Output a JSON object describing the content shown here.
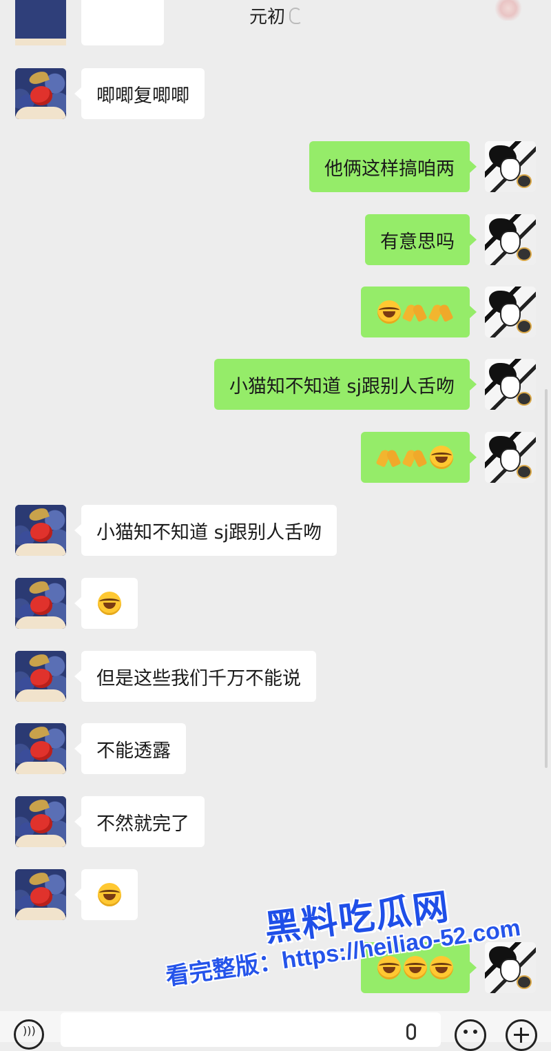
{
  "header": {
    "title": "元初"
  },
  "messages": [
    {
      "side": "left",
      "text": "唧唧复唧唧"
    },
    {
      "side": "right",
      "text": "他俩这样搞咱两"
    },
    {
      "side": "right",
      "text": "有意思吗"
    },
    {
      "side": "right",
      "emoji": [
        "laugh-cry",
        "clap",
        "clap"
      ]
    },
    {
      "side": "right",
      "text": "小猫知不知道 sj跟别人舌吻"
    },
    {
      "side": "right",
      "emoji": [
        "clap",
        "clap",
        "laugh-cry"
      ]
    },
    {
      "side": "left",
      "text": "小猫知不知道 sj跟别人舌吻"
    },
    {
      "side": "left",
      "emoji": [
        "laugh-cry"
      ]
    },
    {
      "side": "left",
      "text": "但是这些我们千万不能说"
    },
    {
      "side": "left",
      "text": "不能透露"
    },
    {
      "side": "left",
      "text": "不然就完了"
    },
    {
      "side": "left",
      "emoji": [
        "laugh-cry"
      ]
    },
    {
      "side": "right",
      "emoji": [
        "laugh-cry",
        "laugh-cry",
        "laugh-cry"
      ]
    }
  ],
  "watermark": {
    "title": "黑料吃瓜网",
    "url": "看完整版：https://heiliao-52.com"
  },
  "icons": {
    "voice": "voice-icon",
    "mic": "mic-icon",
    "emoji": "emoji-icon",
    "plus": "plus-icon",
    "ear": "ear-icon"
  },
  "colors": {
    "background": "#ededed",
    "sent_bubble": "#95ec69",
    "received_bubble": "#ffffff",
    "watermark_blue": "#1f4fe8"
  }
}
